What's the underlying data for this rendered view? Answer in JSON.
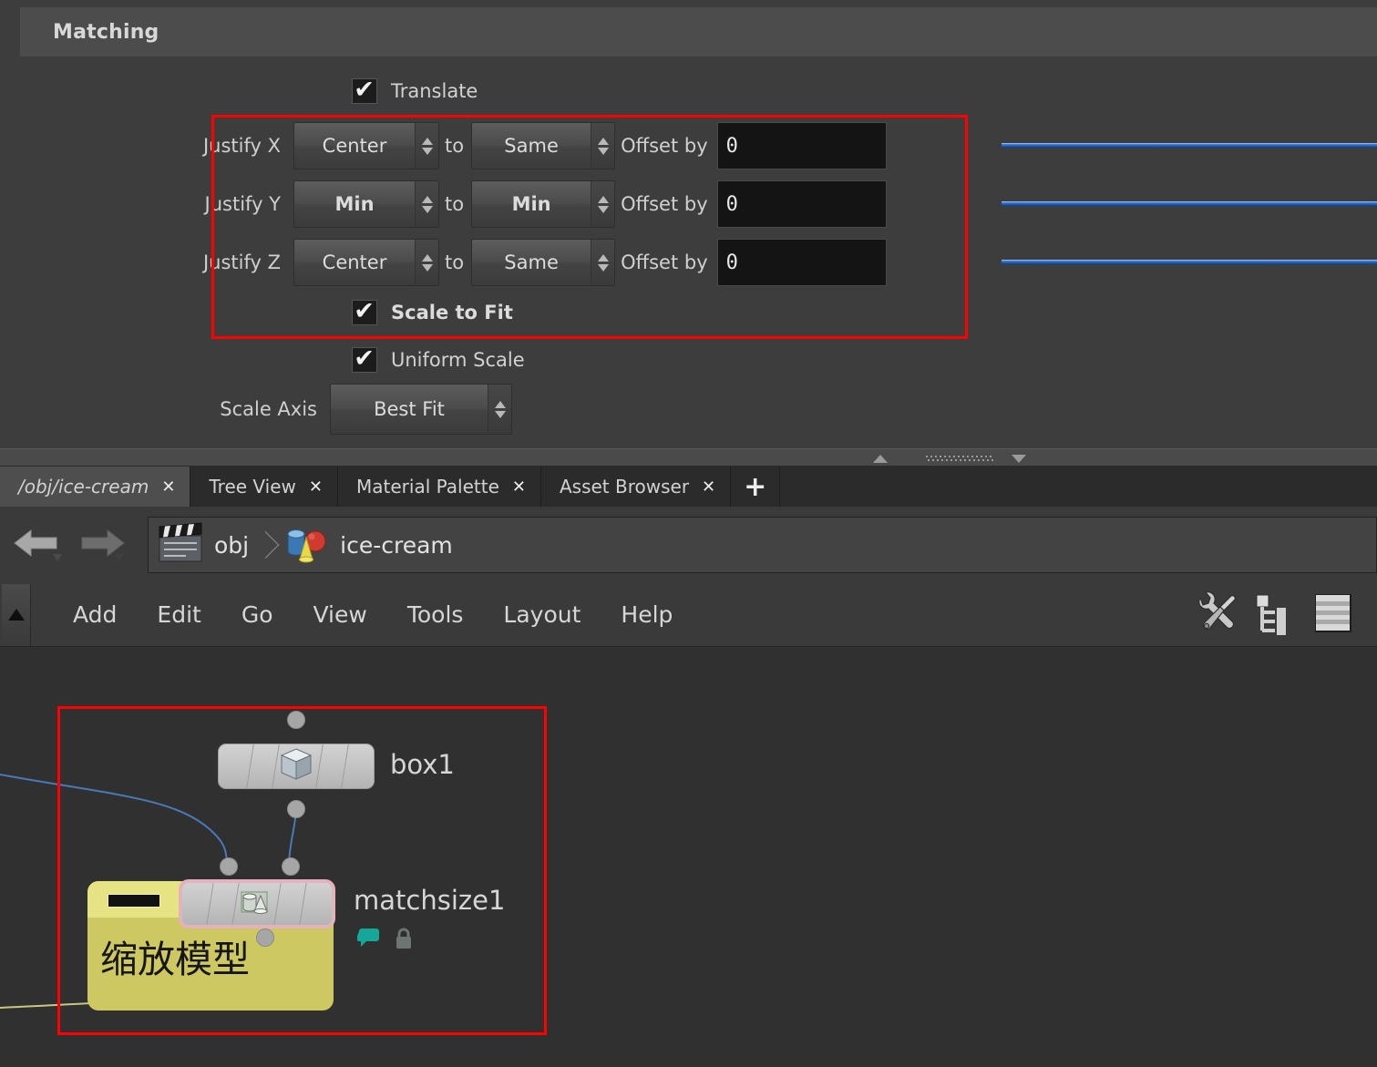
{
  "parameters": {
    "section_title": "Matching",
    "translate": {
      "label": "Translate",
      "checked": true
    },
    "justify_rows": [
      {
        "label": "Justify X",
        "from": "Center",
        "to_label": "to",
        "to": "Same",
        "offset_label": "Offset by",
        "offset_value": "0"
      },
      {
        "label": "Justify Y",
        "from": "Min",
        "to_label": "to",
        "to": "Min",
        "offset_label": "Offset by",
        "offset_value": "0"
      },
      {
        "label": "Justify Z",
        "from": "Center",
        "to_label": "to",
        "to": "Same",
        "offset_label": "Offset by",
        "offset_value": "0"
      }
    ],
    "scale_to_fit": {
      "label": "Scale to Fit",
      "checked": true
    },
    "uniform_scale": {
      "label": "Uniform Scale",
      "checked": true
    },
    "scale_axis": {
      "label": "Scale Axis",
      "value": "Best Fit"
    },
    "annotation_color": "#ff0000"
  },
  "tabs": {
    "items": [
      {
        "label": "/obj/ice-cream",
        "active": true,
        "close": "✕"
      },
      {
        "label": "Tree View",
        "active": false,
        "close": "✕"
      },
      {
        "label": "Material Palette",
        "active": false,
        "close": "✕"
      },
      {
        "label": "Asset Browser",
        "active": false,
        "close": "✕"
      }
    ],
    "add_label": "+"
  },
  "breadcrumb": {
    "back_icon": "back-arrow-icon",
    "forward_icon": "forward-arrow-icon",
    "crumbs": [
      {
        "label": "obj",
        "icon": "clapperboard-icon"
      },
      {
        "label": "ice-cream",
        "icon": "geometry-object-icon"
      }
    ]
  },
  "menubar": {
    "scroll_icon": "triangle-up-icon",
    "items": [
      "Add",
      "Edit",
      "Go",
      "View",
      "Tools",
      "Layout",
      "Help"
    ],
    "tools": [
      "tools-wrench-icon",
      "tree-hierarchy-icon",
      "list-layers-icon"
    ]
  },
  "graph": {
    "nodes": [
      {
        "name": "box1",
        "icon": "box-cube-icon",
        "selected": false
      },
      {
        "name": "matchsize1",
        "icon": "matchsize-icon",
        "selected": true,
        "comment_badge": "comment-bubble-icon",
        "lock_badge": "lock-icon"
      }
    ],
    "sticky_note": {
      "text": "缩放模型",
      "color": "#cdc862",
      "header_color": "#e6e384"
    },
    "wire_color": "#4a79b8"
  }
}
